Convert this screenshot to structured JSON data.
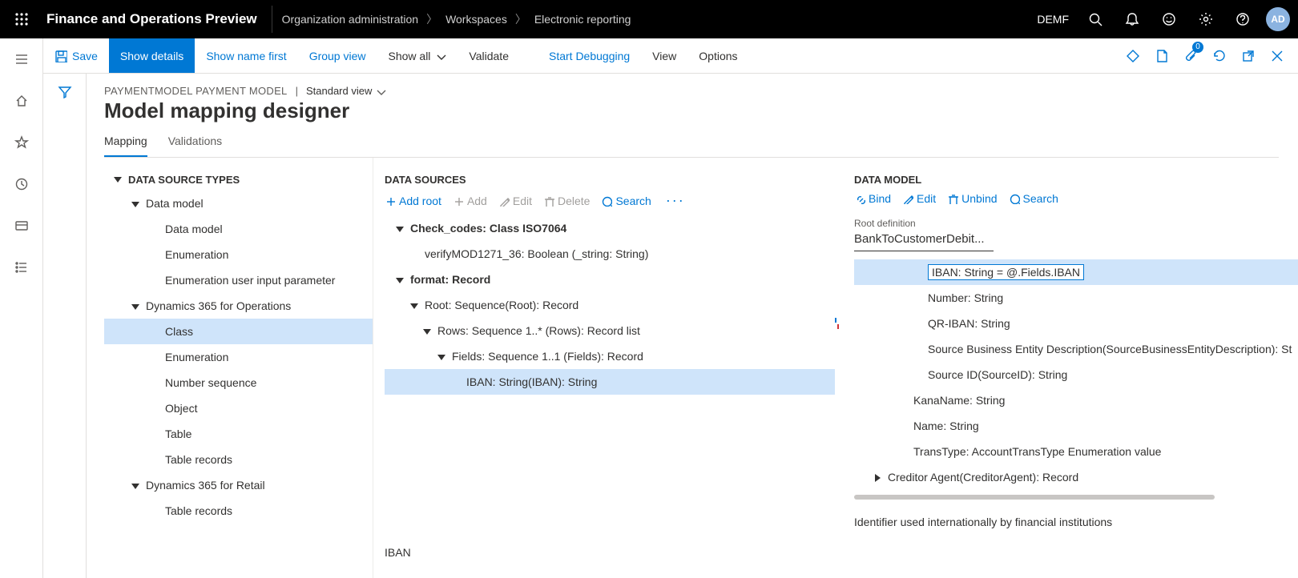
{
  "header": {
    "app_title": "Finance and Operations Preview",
    "breadcrumb": [
      "Organization administration",
      "Workspaces",
      "Electronic reporting"
    ],
    "company": "DEMF",
    "avatar": "AD"
  },
  "cmdbar": {
    "save": "Save",
    "show_details": "Show details",
    "show_name_first": "Show name first",
    "group_view": "Group view",
    "show_all": "Show all",
    "validate": "Validate",
    "start_debugging": "Start Debugging",
    "view": "View",
    "options": "Options",
    "badge_count": "0"
  },
  "page": {
    "meta_left": "PAYMENTMODEL PAYMENT MODEL",
    "meta_sep": "|",
    "view_name": "Standard view",
    "title": "Model mapping designer"
  },
  "tabs": {
    "mapping": "Mapping",
    "validations": "Validations"
  },
  "ds_types": {
    "header": "DATA SOURCE TYPES",
    "items": [
      {
        "label": "Data model",
        "expand": true,
        "level": 1
      },
      {
        "label": "Data model",
        "level": 2
      },
      {
        "label": "Enumeration",
        "level": 2
      },
      {
        "label": "Enumeration user input parameter",
        "level": 2
      },
      {
        "label": "Dynamics 365 for Operations",
        "expand": true,
        "level": 1
      },
      {
        "label": "Class",
        "level": 2,
        "selected": true
      },
      {
        "label": "Enumeration",
        "level": 2
      },
      {
        "label": "Number sequence",
        "level": 2
      },
      {
        "label": "Object",
        "level": 2
      },
      {
        "label": "Table",
        "level": 2
      },
      {
        "label": "Table records",
        "level": 2
      },
      {
        "label": "Dynamics 365 for Retail",
        "expand": true,
        "level": 1
      },
      {
        "label": "Table records",
        "level": 2
      }
    ]
  },
  "ds": {
    "header": "DATA SOURCES",
    "toolbar": {
      "add_root": "Add root",
      "add": "Add",
      "edit": "Edit",
      "delete": "Delete",
      "search": "Search"
    },
    "tree": [
      {
        "label": "Check_codes: Class ISO7064",
        "expand": true,
        "level": 0,
        "bold": true
      },
      {
        "label": "verifyMOD1271_36: Boolean (_string: String)",
        "level": 1
      },
      {
        "label": "format: Record",
        "expand": true,
        "level": 0,
        "bold": true
      },
      {
        "label": "Root: Sequence(Root): Record",
        "expand": true,
        "level": 1
      },
      {
        "label": "Rows: Sequence 1..* (Rows): Record list",
        "expand": true,
        "level": 2
      },
      {
        "label": "Fields: Sequence 1..1 (Fields): Record",
        "expand": true,
        "level": 3
      },
      {
        "label": "IBAN: String(IBAN): String",
        "level": 4,
        "selected": true
      }
    ],
    "footer": "IBAN"
  },
  "dm": {
    "header": "DATA MODEL",
    "toolbar": {
      "bind": "Bind",
      "edit": "Edit",
      "unbind": "Unbind",
      "search": "Search"
    },
    "root_def_label": "Root definition",
    "root_def_value": "BankToCustomerDebit...",
    "tree": [
      {
        "label": "IBAN: String = @.Fields.IBAN",
        "level": 2,
        "selected": true,
        "boxed": true
      },
      {
        "label": "Number: String",
        "level": 2
      },
      {
        "label": "QR-IBAN: String",
        "level": 2
      },
      {
        "label": "Source Business Entity Description(SourceBusinessEntityDescription): St",
        "level": 2
      },
      {
        "label": "Source ID(SourceID): String",
        "level": 2
      },
      {
        "label": "KanaName: String",
        "level": 1
      },
      {
        "label": "Name: String",
        "level": 1
      },
      {
        "label": "TransType: AccountTransType Enumeration value",
        "level": 1
      },
      {
        "label": "Creditor Agent(CreditorAgent): Record",
        "level": 0,
        "expand": "right"
      }
    ],
    "description": "Identifier used internationally by financial institutions"
  }
}
